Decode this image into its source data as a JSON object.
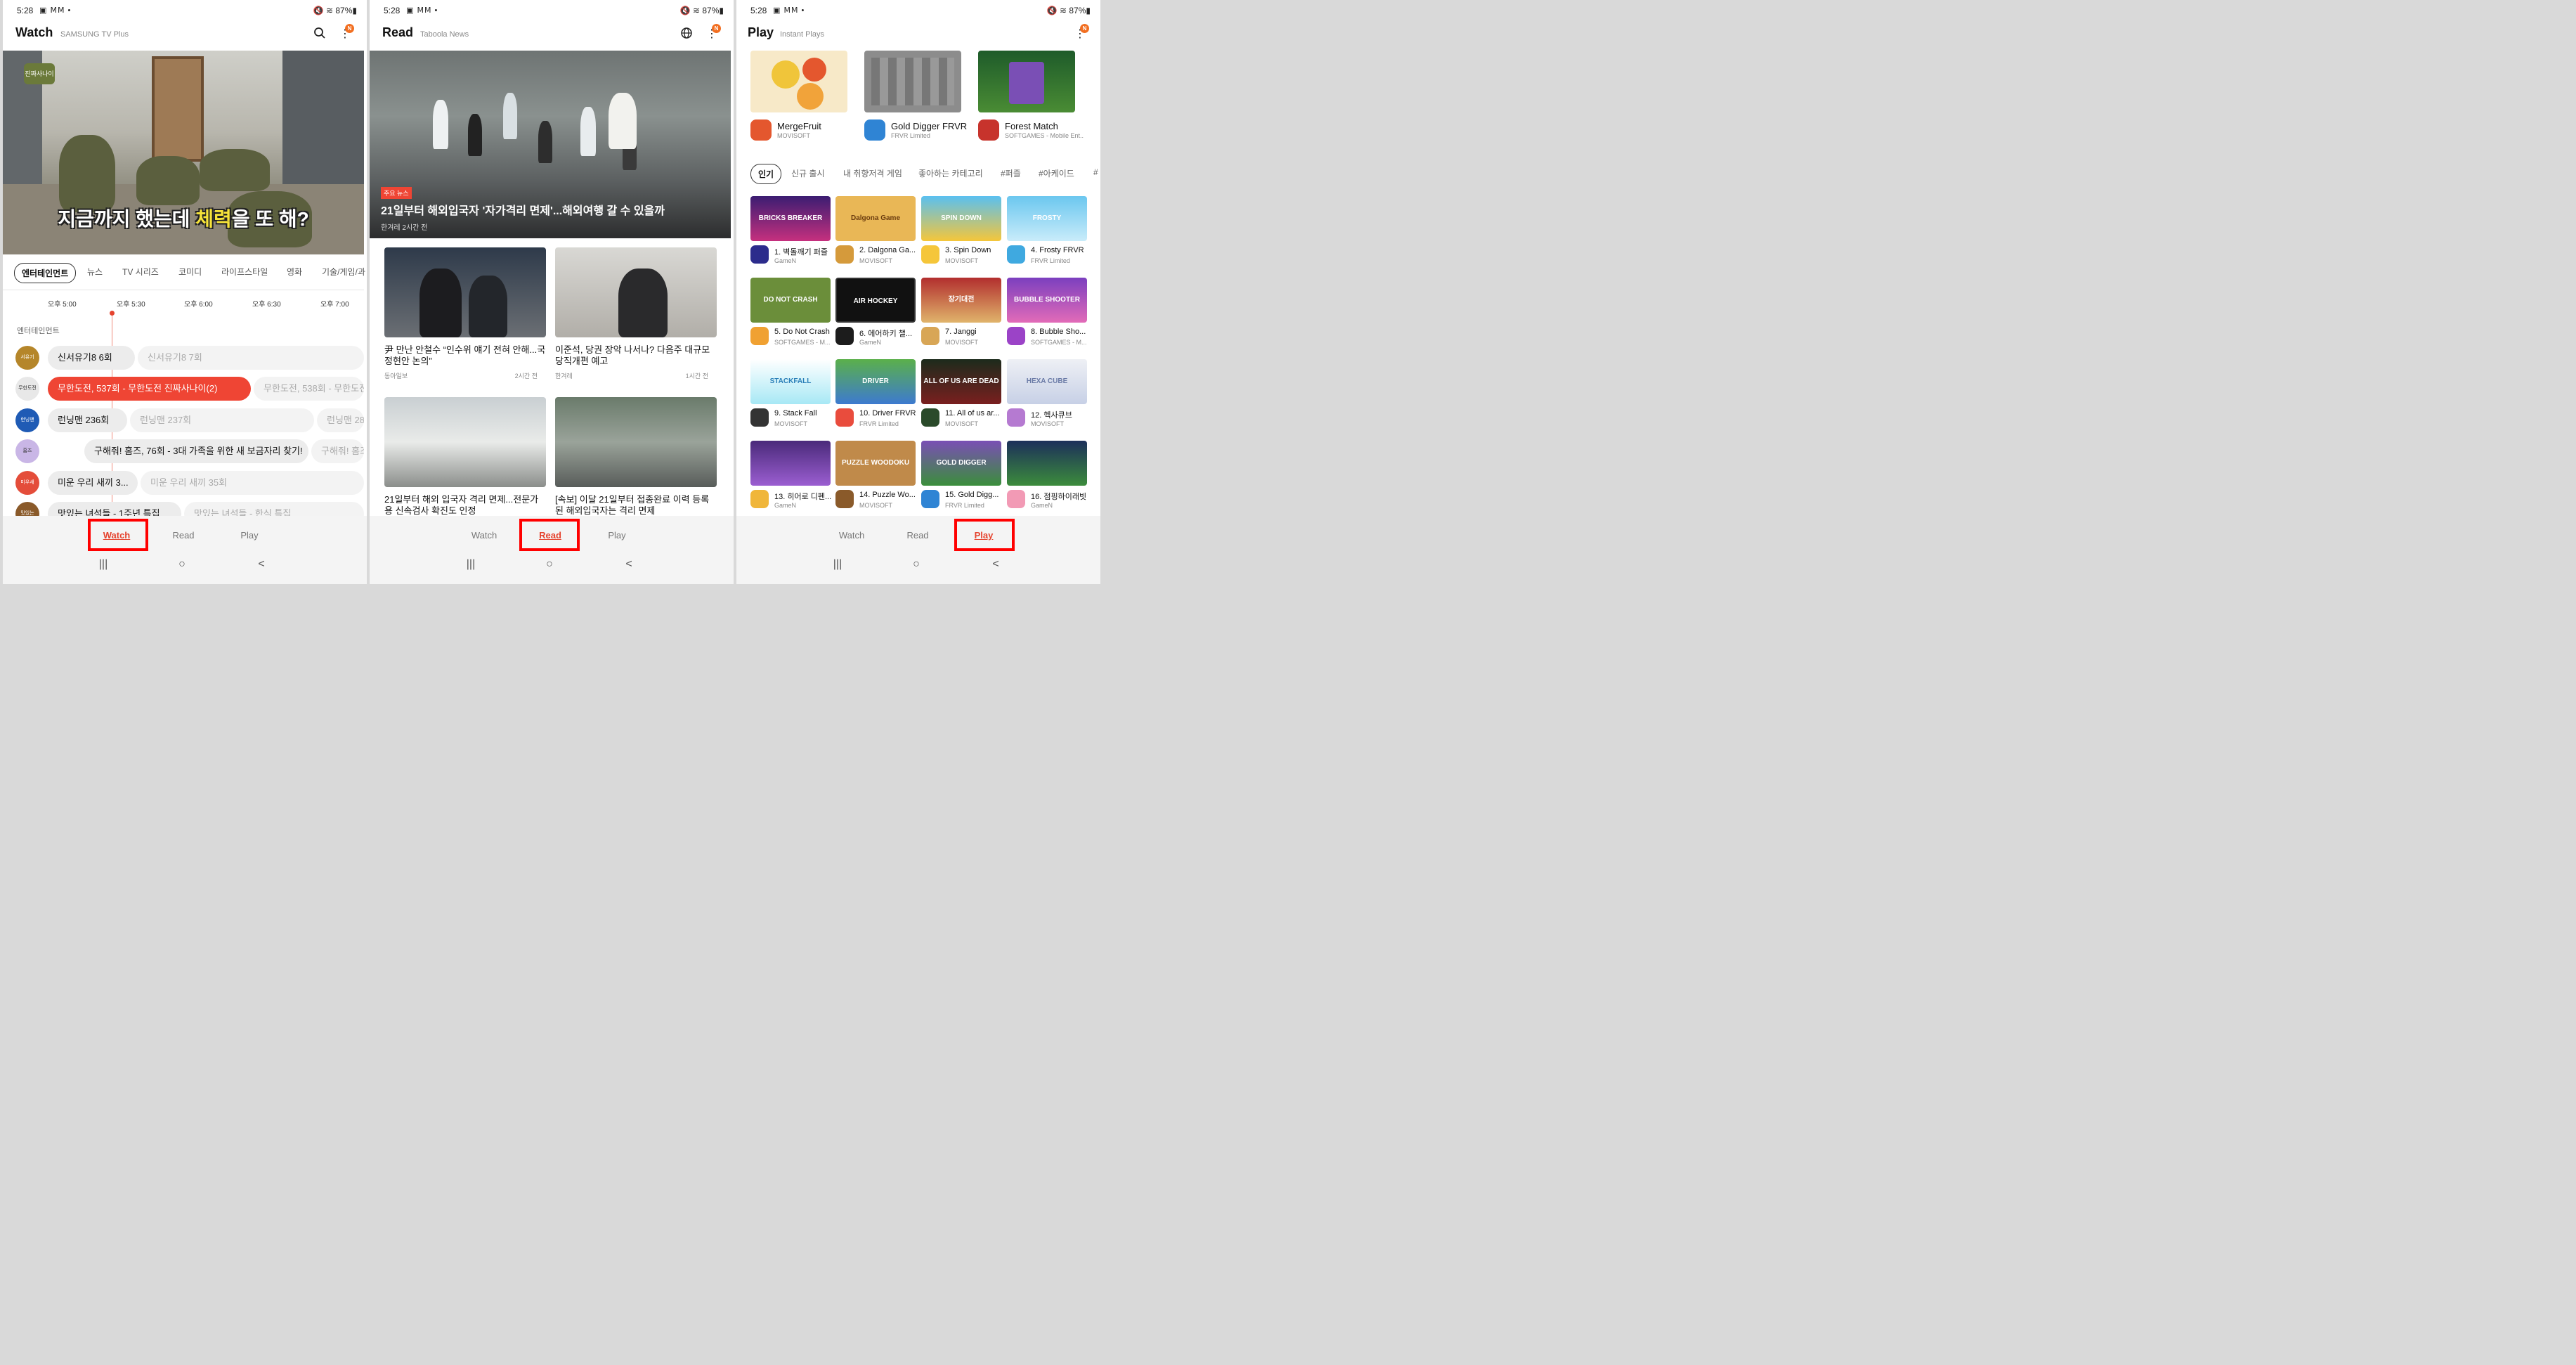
{
  "status": {
    "time": "5:28",
    "icons": "▣ ⅯⅯ •",
    "right": "🔇 ≋ 87%▮"
  },
  "watch": {
    "title": "Watch",
    "subtitle": "SAMSUNG TV Plus",
    "badge": "N",
    "hero_caption_a": "지금까지 했는데 ",
    "hero_caption_b": "체력",
    "hero_caption_c": "을 또 해?",
    "hero_logo": "진짜사나이",
    "categories": [
      "엔터테인먼트",
      "뉴스",
      "TV 시리즈",
      "코미디",
      "라이프스타일",
      "영화",
      "기술/게임/과"
    ],
    "times": [
      "오후 5:00",
      "오후 5:30",
      "오후 6:00",
      "오후 6:30",
      "오후 7:00"
    ],
    "group_label": "엔터테인먼트",
    "channels": [
      {
        "logo": "서유기",
        "color": "#b5862a",
        "programs": [
          "신서유기8 6회",
          "신서유기8 7회"
        ]
      },
      {
        "logo": "무한도전",
        "color": "#e8e8e8",
        "programs": [
          "무한도전, 537회 - 무한도전 진짜사나이(2)",
          "무한도전, 538회 - 무한도전"
        ]
      },
      {
        "logo": "런닝맨",
        "color": "#1f5bb5",
        "programs": [
          "런닝맨 236회",
          "런닝맨 237회",
          "런닝맨 28"
        ]
      },
      {
        "logo": "홈즈",
        "color": "#c9b6e6",
        "programs": [
          "구해줘! 홈즈, 76회 - 3대 가족을 위한 새 보금자리 찾기!",
          "구해줘! 홈즈"
        ]
      },
      {
        "logo": "미우새",
        "color": "#e44d3a",
        "programs": [
          "미운 우리 새끼 3...",
          "미운 우리 새끼 35회"
        ]
      },
      {
        "logo": "맛있는",
        "color": "#8a5a2a",
        "programs": [
          "맛있는 녀석들 - 1주년 특집",
          "맛있는 녀석들 - 한식 특집"
        ]
      }
    ]
  },
  "read": {
    "title": "Read",
    "subtitle": "Taboola News",
    "badge": "N",
    "hero": {
      "tag": "주요 뉴스",
      "headline": "21일부터 해외입국자 '자가격리 면제'...해외여행 갈 수 있을까",
      "source": "한겨레 2시간 전"
    },
    "articles": [
      {
        "title": "尹 만난 안철수 “인수위 얘기 전혀 안해...국정현안 논의”",
        "source": "동아일보",
        "ago": "2시간 전"
      },
      {
        "title": "이준석, 당권 장악 나서나? 다음주 대규모 당직개편 예고",
        "source": "한겨레",
        "ago": "1시간 전"
      },
      {
        "title": "21일부터 해외 입국자 격리 면제...전문가용 신속검사 확진도 인정",
        "source": "",
        "ago": ""
      },
      {
        "title": "[속보] 이달 21일부터 접종완료 이력 등록된 해외입국자는 격리 면제",
        "source": "",
        "ago": ""
      }
    ]
  },
  "play": {
    "title": "Play",
    "subtitle": "Instant Plays",
    "badge": "N",
    "featured": [
      {
        "name": "MergeFruit",
        "dev": "MOVISOFT"
      },
      {
        "name": "Gold Digger FRVR",
        "dev": "FRVR Limited"
      },
      {
        "name": "Forest Match",
        "dev": "SOFTGAMES - Mobile Ent..."
      }
    ],
    "categories": [
      "인기",
      "신규 출시",
      "내 취향저격 게임",
      "좋아하는 카테고리",
      "#퍼즐",
      "#아케이드",
      "#"
    ],
    "games": [
      {
        "name": "1. 벽돌깨기 퍼즐",
        "dev": "GameN",
        "label": "BRICKS BREAKER"
      },
      {
        "name": "2. Dalgona Ga...",
        "dev": "MOVISOFT",
        "label": "Dalgona Game"
      },
      {
        "name": "3. Spin Down",
        "dev": "MOVISOFT",
        "label": "SPIN DOWN"
      },
      {
        "name": "4. Frosty FRVR",
        "dev": "FRVR Limited",
        "label": "FROSTY"
      },
      {
        "name": "5. Do Not Crash",
        "dev": "SOFTGAMES - M...",
        "label": "DO NOT CRASH"
      },
      {
        "name": "6. 에어하키 챌...",
        "dev": "GameN",
        "label": "AIR HOCKEY"
      },
      {
        "name": "7. Janggi",
        "dev": "MOVISOFT",
        "label": "장기대전"
      },
      {
        "name": "8. Bubble Sho...",
        "dev": "SOFTGAMES - M...",
        "label": "BUBBLE SHOOTER"
      },
      {
        "name": "9. Stack Fall",
        "dev": "MOVISOFT",
        "label": "STACKFALL"
      },
      {
        "name": "10. Driver FRVR",
        "dev": "FRVR Limited",
        "label": "DRIVER"
      },
      {
        "name": "11. All of us ar...",
        "dev": "MOVISOFT",
        "label": "ALL OF US ARE DEAD"
      },
      {
        "name": "12. 헥사큐브",
        "dev": "MOVISOFT",
        "label": "HEXA CUBE"
      },
      {
        "name": "13. 히어로 디펜...",
        "dev": "GameN",
        "label": ""
      },
      {
        "name": "14. Puzzle Wo...",
        "dev": "MOVISOFT",
        "label": "PUZZLE WOODOKU"
      },
      {
        "name": "15. Gold Digg...",
        "dev": "FRVR Limited",
        "label": "GOLD DIGGER"
      },
      {
        "name": "16. 점핑하이래빗",
        "dev": "GameN",
        "label": ""
      }
    ]
  },
  "nav": {
    "watch": "Watch",
    "read": "Read",
    "play": "Play"
  },
  "sysnav": {
    "recents": "|||",
    "home": "○",
    "back": "<"
  }
}
